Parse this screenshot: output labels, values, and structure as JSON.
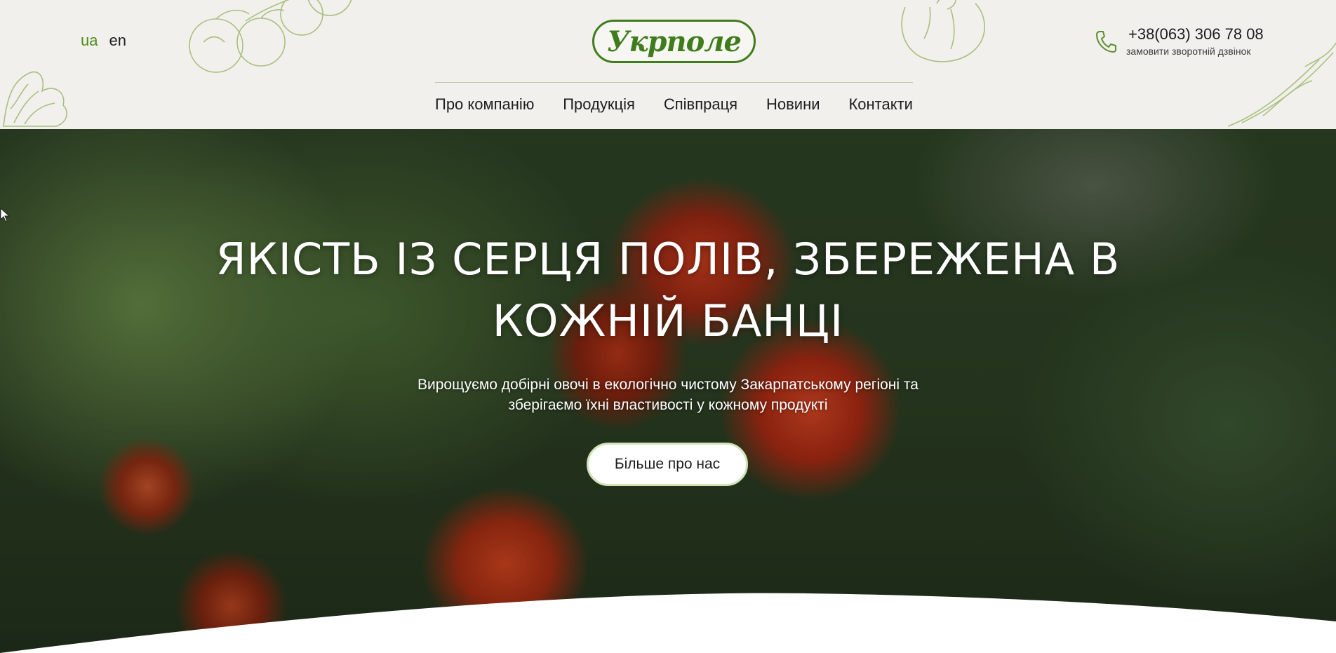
{
  "header": {
    "languages": [
      {
        "code": "ua",
        "active": true
      },
      {
        "code": "en",
        "active": false
      }
    ],
    "logo_text": "Укрполе",
    "nav": [
      "Про компанію",
      "Продукція",
      "Співпраця",
      "Новини",
      "Контакти"
    ],
    "phone": "+38(063) 306 78 08",
    "callback_link": "замовити зворотній дзвінок",
    "phone_icon": "phone-icon"
  },
  "hero": {
    "title_line1": "ЯКІСТЬ ІЗ СЕРЦЯ ПОЛІВ, ЗБЕРЕЖЕНА В",
    "title_line2": "КОЖНІЙ БАНЦІ",
    "subtitle_line1": "Вирощуємо добірні овочі в екологічно чистому Закарпатському регіоні та",
    "subtitle_line2": "зберігаємо їхні властивості у кожному продукті",
    "button_label": "Більше про нас"
  },
  "colors": {
    "brand_green": "#3f7d1c",
    "header_bg": "#f1f0ec",
    "active_lang": "#4f8a1e"
  }
}
